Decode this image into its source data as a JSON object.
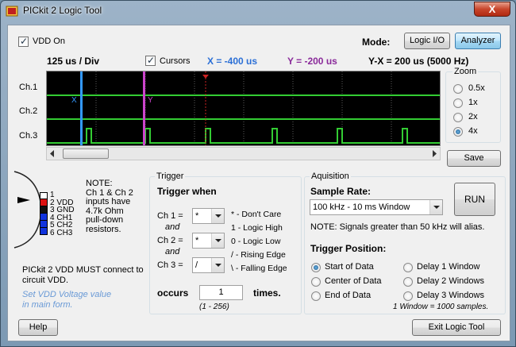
{
  "window": {
    "title": "PICkit 2 Logic Tool",
    "close_symbol": "X"
  },
  "top": {
    "vdd_on_label": "VDD On",
    "mode_label": "Mode:",
    "logic_io_label": "Logic I/O",
    "analyzer_label": "Analyzer",
    "time_div": "125 us / Div",
    "cursors_label": "Cursors",
    "x_readout": "X = -400 us",
    "y_readout": "Y =  -200 us",
    "yx_readout": "Y-X =  200 us (5000 Hz)"
  },
  "scope": {
    "channels": [
      "Ch.1",
      "Ch.2",
      "Ch.3"
    ],
    "cursor_x_label": "X",
    "cursor_y_label": "Y",
    "colors": {
      "trace": "#33cc33",
      "cursor_x": "#3399ff",
      "cursor_y": "#cc44cc",
      "trigger": "#cc2222",
      "grid": "#666666"
    }
  },
  "zoom": {
    "title": "Zoom",
    "options": [
      "0.5x",
      "1x",
      "2x",
      "4x"
    ],
    "selected": "4x",
    "save_label": "Save"
  },
  "connector": {
    "pins": [
      {
        "num": "1",
        "label": ""
      },
      {
        "num": "2",
        "label": "VDD"
      },
      {
        "num": "3",
        "label": "GND"
      },
      {
        "num": "4",
        "label": "CH1"
      },
      {
        "num": "5",
        "label": "CH2"
      },
      {
        "num": "6",
        "label": "CH3"
      }
    ],
    "note": [
      "NOTE:",
      "Ch 1 & Ch 2",
      "inputs have",
      "4.7k Ohm",
      "pull-down",
      "resistors."
    ],
    "vdd_warning": [
      "PICkit 2 VDD MUST connect to",
      "circuit VDD."
    ],
    "vdd_hint": [
      "Set VDD Voltage value",
      "in main form."
    ]
  },
  "trigger": {
    "group_title": "Trigger",
    "heading": "Trigger when",
    "ch1_label": "Ch 1 =",
    "ch1_value": "*",
    "ch2_label": "Ch 2 =",
    "ch2_value": "*",
    "ch3_label": "Ch 3 =",
    "ch3_value": "/",
    "and_label": "and",
    "legend": [
      "* - Don't Care",
      "1 - Logic High",
      "0 - Logic Low",
      "/ - Rising Edge",
      "\\ - Falling Edge"
    ],
    "occurs_label": "occurs",
    "occurs_value": "1",
    "times_label": "times.",
    "range_label": "(1 - 256)"
  },
  "acquisition": {
    "group_title": "Aquisition",
    "sample_rate_label": "Sample Rate:",
    "sample_rate_value": "100 kHz - 10 ms Window",
    "run_label": "RUN",
    "alias_note": "NOTE: Signals greater than 50 kHz will alias.",
    "trigger_position_label": "Trigger Position:",
    "positions_left": [
      "Start of Data",
      "Center of Data",
      "End of Data"
    ],
    "positions_right": [
      "Delay 1 Window",
      "Delay 2 Windows",
      "Delay 3 Windows"
    ],
    "selected_position": "Start of Data",
    "window_note": "1 Window = 1000 samples."
  },
  "bottom": {
    "help_label": "Help",
    "exit_label": "Exit Logic Tool"
  }
}
